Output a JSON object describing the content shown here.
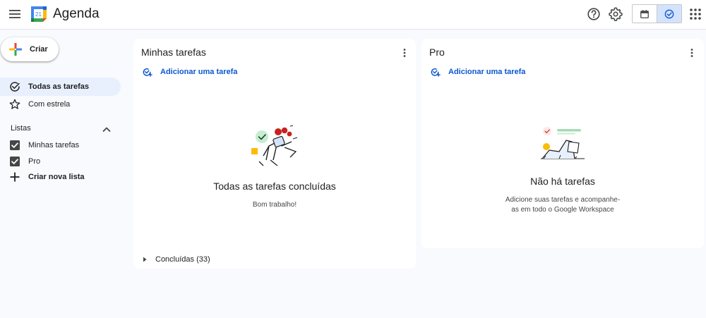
{
  "header": {
    "app_title": "Agenda",
    "logo_day": "21"
  },
  "sidebar": {
    "create_label": "Criar",
    "items": [
      {
        "label": "Todas as tarefas",
        "icon": "check-circle-icon",
        "active": true
      },
      {
        "label": "Com estrela",
        "icon": "star-outline-icon",
        "active": false
      }
    ],
    "lists_section_label": "Listas",
    "lists": [
      {
        "label": "Minhas tarefas",
        "checked": true
      },
      {
        "label": "Pro",
        "checked": true
      }
    ],
    "new_list_label": "Criar nova lista"
  },
  "lists_panels": [
    {
      "title": "Minhas tarefas",
      "add_task_label": "Adicionar uma tarefa",
      "empty_title": "Todas as tarefas concluídas",
      "empty_subtitle": "Bom trabalho!",
      "completed_label": "Concluídas (33)"
    },
    {
      "title": "Pro",
      "add_task_label": "Adicionar uma tarefa",
      "empty_title": "Não há tarefas",
      "empty_subtitle_line1": "Adicione suas tarefas e acompanhe-",
      "empty_subtitle_line2": "as em todo o Google Workspace"
    }
  ],
  "colors": {
    "accent": "#0b57d0",
    "active_nav": "#e8f0fe",
    "background": "#f8fafd"
  }
}
